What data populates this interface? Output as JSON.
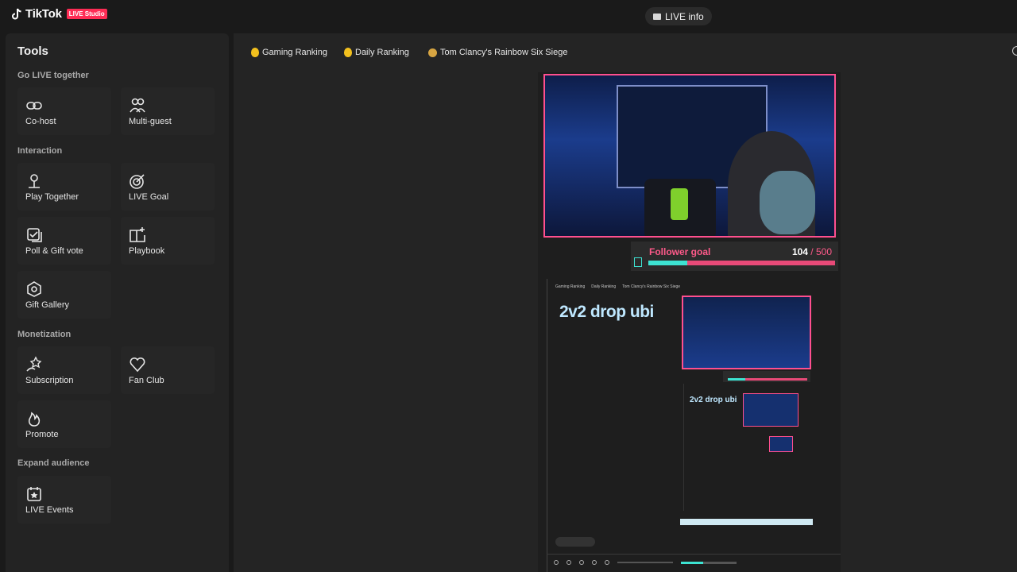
{
  "app": {
    "logo_text": "TikTok",
    "logo_badge": "LIVE Studio",
    "live_info_label": "LIVE info"
  },
  "sidebar": {
    "title": "Tools",
    "sections": [
      {
        "title": "Go LIVE together",
        "items": [
          {
            "label": "Co-host",
            "icon": "link-icon"
          },
          {
            "label": "Multi-guest",
            "icon": "people-icon"
          }
        ]
      },
      {
        "title": "Interaction",
        "items": [
          {
            "label": "Play Together",
            "icon": "person-joystick-icon"
          },
          {
            "label": "LIVE Goal",
            "icon": "target-icon"
          },
          {
            "label": "Poll & Gift vote",
            "icon": "poll-icon"
          },
          {
            "label": "Playbook",
            "icon": "book-sparkle-icon"
          },
          {
            "label": "Gift Gallery",
            "icon": "gift-gallery-icon"
          }
        ]
      },
      {
        "title": "Monetization",
        "items": [
          {
            "label": "Subscription",
            "icon": "star-hand-icon"
          },
          {
            "label": "Fan Club",
            "icon": "heart-icon"
          },
          {
            "label": "Promote",
            "icon": "flame-icon"
          }
        ]
      },
      {
        "title": "Expand audience",
        "items": [
          {
            "label": "LIVE Events",
            "icon": "calendar-star-icon"
          }
        ]
      }
    ]
  },
  "main": {
    "chips": [
      {
        "label": "Gaming Ranking",
        "icon": "gold-medal-icon"
      },
      {
        "label": "Daily Ranking",
        "icon": "gold-medal-icon"
      },
      {
        "label": "Tom Clancy's Rainbow Six Siege",
        "icon": "bronze-medal-icon"
      }
    ],
    "preview": {
      "follower_goal_label": "Follower goal",
      "follower_count": "104",
      "follower_target": " / 500",
      "follower_progress": 0.208,
      "stream_title": "2v2 drop ubi",
      "mini_chips": [
        "Gaming Ranking",
        "Daily Ranking",
        "Tom Clancy's Rainbow Six Siege"
      ]
    }
  },
  "colors": {
    "accent": "#fe2c55",
    "goal_pink": "#ff5a8a",
    "goal_teal": "#3de3d2"
  }
}
